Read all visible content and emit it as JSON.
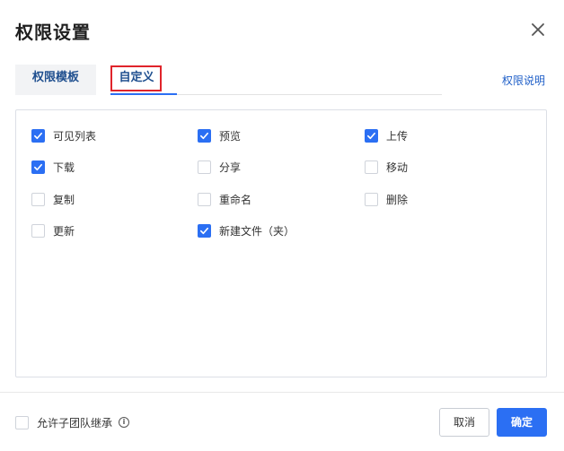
{
  "dialog": {
    "title": "权限设置"
  },
  "tabs": [
    {
      "label": "权限模板"
    },
    {
      "label": "自定义"
    }
  ],
  "help_link": "权限说明",
  "permissions": [
    {
      "label": "可见列表",
      "checked": true
    },
    {
      "label": "预览",
      "checked": true
    },
    {
      "label": "上传",
      "checked": true
    },
    {
      "label": "下载",
      "checked": true
    },
    {
      "label": "分享",
      "checked": false
    },
    {
      "label": "移动",
      "checked": false
    },
    {
      "label": "复制",
      "checked": false
    },
    {
      "label": "重命名",
      "checked": false
    },
    {
      "label": "删除",
      "checked": false
    },
    {
      "label": "更新",
      "checked": false
    },
    {
      "label": "新建文件（夹）",
      "checked": true
    }
  ],
  "footer": {
    "inherit_label": "允许子团队继承",
    "inherit_checked": false,
    "info_icon": "i",
    "cancel_label": "取消",
    "ok_label": "确定"
  },
  "colors": {
    "accent": "#2b6ff3",
    "highlight_box": "#e0242b"
  }
}
